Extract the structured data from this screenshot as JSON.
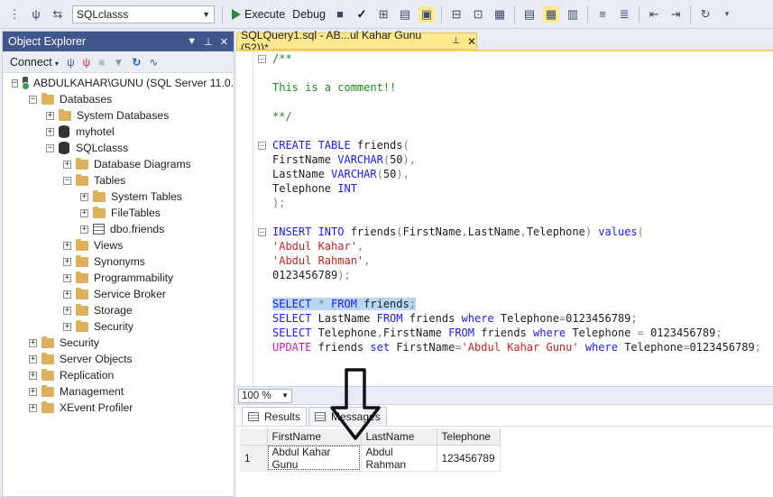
{
  "toolbar": {
    "database": "SQLclasss",
    "execute_label": "Execute",
    "debug_label": "Debug"
  },
  "object_explorer": {
    "title": "Object Explorer",
    "connect_label": "Connect",
    "tree": [
      {
        "label": "ABDULKAHAR\\GUNU (SQL Server 11.0.",
        "indent": 0,
        "expander": "−",
        "icon": "server-icon"
      },
      {
        "label": "Databases",
        "indent": 1,
        "expander": "−",
        "icon": "folder-icon"
      },
      {
        "label": "System Databases",
        "indent": 2,
        "expander": "+",
        "icon": "folder-icon"
      },
      {
        "label": "myhotel",
        "indent": 2,
        "expander": "+",
        "icon": "database-icon"
      },
      {
        "label": "SQLclasss",
        "indent": 2,
        "expander": "−",
        "icon": "database-icon"
      },
      {
        "label": "Database Diagrams",
        "indent": 3,
        "expander": "+",
        "icon": "folder-icon"
      },
      {
        "label": "Tables",
        "indent": 3,
        "expander": "−",
        "icon": "folder-icon"
      },
      {
        "label": "System Tables",
        "indent": 4,
        "expander": "+",
        "icon": "folder-icon"
      },
      {
        "label": "FileTables",
        "indent": 4,
        "expander": "+",
        "icon": "folder-icon"
      },
      {
        "label": "dbo.friends",
        "indent": 4,
        "expander": "+",
        "icon": "table-icon"
      },
      {
        "label": "Views",
        "indent": 3,
        "expander": "+",
        "icon": "folder-icon"
      },
      {
        "label": "Synonyms",
        "indent": 3,
        "expander": "+",
        "icon": "folder-icon"
      },
      {
        "label": "Programmability",
        "indent": 3,
        "expander": "+",
        "icon": "folder-icon"
      },
      {
        "label": "Service Broker",
        "indent": 3,
        "expander": "+",
        "icon": "folder-icon"
      },
      {
        "label": "Storage",
        "indent": 3,
        "expander": "+",
        "icon": "folder-icon"
      },
      {
        "label": "Security",
        "indent": 3,
        "expander": "+",
        "icon": "folder-icon"
      },
      {
        "label": "Security",
        "indent": 1,
        "expander": "+",
        "icon": "folder-icon"
      },
      {
        "label": "Server Objects",
        "indent": 1,
        "expander": "+",
        "icon": "folder-icon"
      },
      {
        "label": "Replication",
        "indent": 1,
        "expander": "+",
        "icon": "folder-icon"
      },
      {
        "label": "Management",
        "indent": 1,
        "expander": "+",
        "icon": "folder-icon"
      },
      {
        "label": "XEvent Profiler",
        "indent": 1,
        "expander": "+",
        "icon": "folder-icon"
      }
    ]
  },
  "editor": {
    "tab_title": "SQLQuery1.sql - AB...ul Kahar Gunu (52))*",
    "lines": [
      {
        "fold": "−",
        "parts": [
          [
            "cm",
            "/**"
          ]
        ]
      },
      {
        "parts": []
      },
      {
        "parts": [
          [
            "cm",
            "This is a comment!!"
          ]
        ]
      },
      {
        "parts": []
      },
      {
        "parts": [
          [
            "cm",
            "**/"
          ]
        ]
      },
      {
        "parts": []
      },
      {
        "fold": "−",
        "parts": [
          [
            "kw",
            "CREATE TABLE "
          ],
          [
            "",
            "friends"
          ],
          [
            "gr",
            "("
          ]
        ]
      },
      {
        "parts": [
          [
            "",
            "FirstName "
          ],
          [
            "kw",
            "VARCHAR"
          ],
          [
            "gr",
            "("
          ],
          [
            "",
            "50"
          ],
          [
            "gr",
            "),"
          ]
        ]
      },
      {
        "parts": [
          [
            "",
            "LastName "
          ],
          [
            "kw",
            "VARCHAR"
          ],
          [
            "gr",
            "("
          ],
          [
            "",
            "50"
          ],
          [
            "gr",
            "),"
          ]
        ]
      },
      {
        "parts": [
          [
            "",
            "Telephone "
          ],
          [
            "kw",
            "INT"
          ]
        ]
      },
      {
        "parts": [
          [
            "gr",
            ");"
          ]
        ]
      },
      {
        "parts": []
      },
      {
        "fold": "−",
        "parts": [
          [
            "kw",
            "INSERT INTO "
          ],
          [
            "",
            "friends"
          ],
          [
            "gr",
            "("
          ],
          [
            "",
            "FirstName"
          ],
          [
            "gr",
            ","
          ],
          [
            "",
            "LastName"
          ],
          [
            "gr",
            ","
          ],
          [
            "",
            "Telephone"
          ],
          [
            "gr",
            ") "
          ],
          [
            "kw",
            "values"
          ],
          [
            "gr",
            "("
          ]
        ]
      },
      {
        "parts": [
          [
            "str",
            "'Abdul Kahar'"
          ],
          [
            "gr",
            ","
          ]
        ]
      },
      {
        "parts": [
          [
            "str",
            "'Abdul Rahman'"
          ],
          [
            "gr",
            ","
          ]
        ]
      },
      {
        "parts": [
          [
            "",
            "0123456789"
          ],
          [
            "gr",
            ");"
          ]
        ]
      },
      {
        "parts": []
      },
      {
        "selected": true,
        "parts": [
          [
            "kw",
            "SELECT "
          ],
          [
            "gr",
            "* "
          ],
          [
            "kw",
            "FROM "
          ],
          [
            "",
            "friends"
          ],
          [
            "gr",
            ";"
          ]
        ]
      },
      {
        "parts": [
          [
            "kw",
            "SELECT "
          ],
          [
            "",
            "LastName "
          ],
          [
            "kw",
            "FROM "
          ],
          [
            "",
            "friends "
          ],
          [
            "kw",
            "where "
          ],
          [
            "",
            "Telephone"
          ],
          [
            "gr",
            "="
          ],
          [
            "",
            "0123456789"
          ],
          [
            "gr",
            ";"
          ]
        ]
      },
      {
        "parts": [
          [
            "kw",
            "SELECT "
          ],
          [
            "",
            "Telephone"
          ],
          [
            "gr",
            ","
          ],
          [
            "",
            "FirstName "
          ],
          [
            "kw",
            "FROM "
          ],
          [
            "",
            "friends "
          ],
          [
            "kw",
            "where "
          ],
          [
            "",
            "Telephone "
          ],
          [
            "gr",
            "= "
          ],
          [
            "",
            "0123456789"
          ],
          [
            "gr",
            ";"
          ]
        ]
      },
      {
        "parts": [
          [
            "fn",
            "UPDATE "
          ],
          [
            "",
            "friends "
          ],
          [
            "kw",
            "set "
          ],
          [
            "",
            "FirstName"
          ],
          [
            "gr",
            "="
          ],
          [
            "str",
            "'Abdul Kahar Gunu' "
          ],
          [
            "kw",
            "where "
          ],
          [
            "",
            "Telephone"
          ],
          [
            "gr",
            "="
          ],
          [
            "",
            "0123456789"
          ],
          [
            "gr",
            ";"
          ]
        ]
      }
    ]
  },
  "zoom": "100 %",
  "results": {
    "tabs": [
      {
        "label": "Results",
        "active": true
      },
      {
        "label": "Messages",
        "active": false
      }
    ],
    "columns": [
      "FirstName",
      "LastName",
      "Telephone"
    ],
    "rows": [
      {
        "num": "1",
        "cells": [
          "Abdul Kahar Gunu",
          "Abdul Rahman",
          "123456789"
        ]
      }
    ]
  }
}
